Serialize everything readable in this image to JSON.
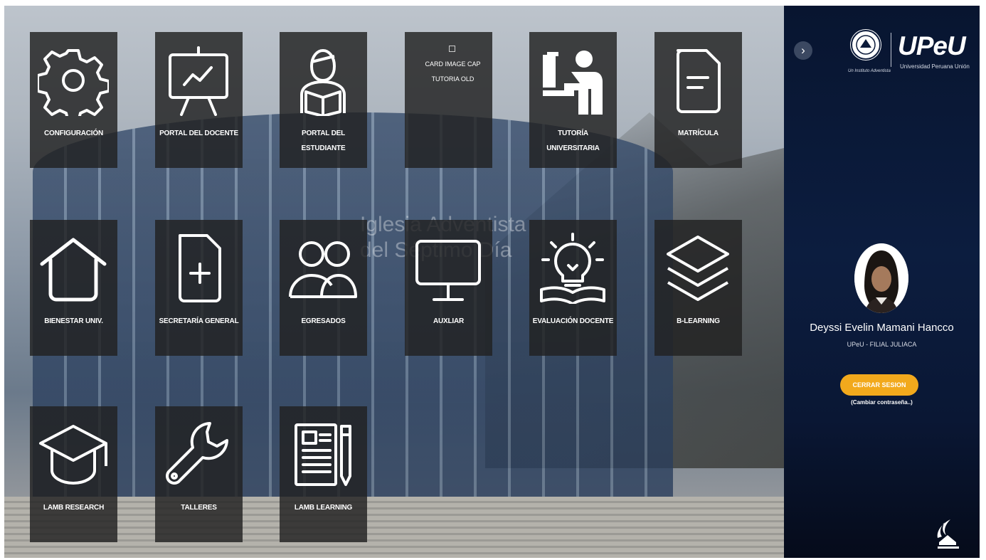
{
  "tiles": [
    {
      "label": "CONFIGURACIÓN",
      "icon": "gear-icon"
    },
    {
      "label": "PORTAL DEL DOCENTE",
      "icon": "presentation-board-icon"
    },
    {
      "label": "PORTAL DEL ESTUDIANTE",
      "icon": "student-reading-icon"
    },
    {
      "label": "TUTORIA OLD",
      "broken_image_alt": "CARD IMAGE CAP"
    },
    {
      "label": "TUTORÍA UNIVERSITARIA",
      "icon": "teacher-icon"
    },
    {
      "label": "MATRÍCULA",
      "icon": "document-icon"
    },
    {
      "label": "BIENESTAR UNIV.",
      "icon": "house-icon"
    },
    {
      "label": "SECRETARÍA GENERAL",
      "icon": "file-add-icon"
    },
    {
      "label": "EGRESADOS",
      "icon": "people-icon"
    },
    {
      "label": "AUXLIAR",
      "icon": "monitor-icon"
    },
    {
      "label": "EVALUACIÓN DOCENTE",
      "icon": "lightbulb-book-icon"
    },
    {
      "label": "B-LEARNING",
      "icon": "layers-icon"
    },
    {
      "label": "LAMB RESEARCH",
      "icon": "graduation-cap-icon"
    },
    {
      "label": "TALLERES",
      "icon": "wrench-icon"
    },
    {
      "label": "LAMB LEARNING",
      "icon": "notepad-pen-icon"
    }
  ],
  "background_text": [
    "Iglesia Adventista",
    "del Séptimo Día"
  ],
  "panel": {
    "toggle_glyph": "›",
    "logo_text": "UPeU",
    "logo_subtitle": "Universidad Peruana Unión",
    "logo_motto": "Un Instituto Adventista",
    "user_name": "Deyssi Evelin Mamani Hancco",
    "user_org": "UPeU - FILIAL JULIACA",
    "logout_label": "CERRAR SESION",
    "change_password_label": "(Cambiar contraseña..)"
  },
  "colors": {
    "tile_bg": "#212121",
    "panel_bg": "#0b1a3a",
    "logout_button": "#f2a91c"
  }
}
